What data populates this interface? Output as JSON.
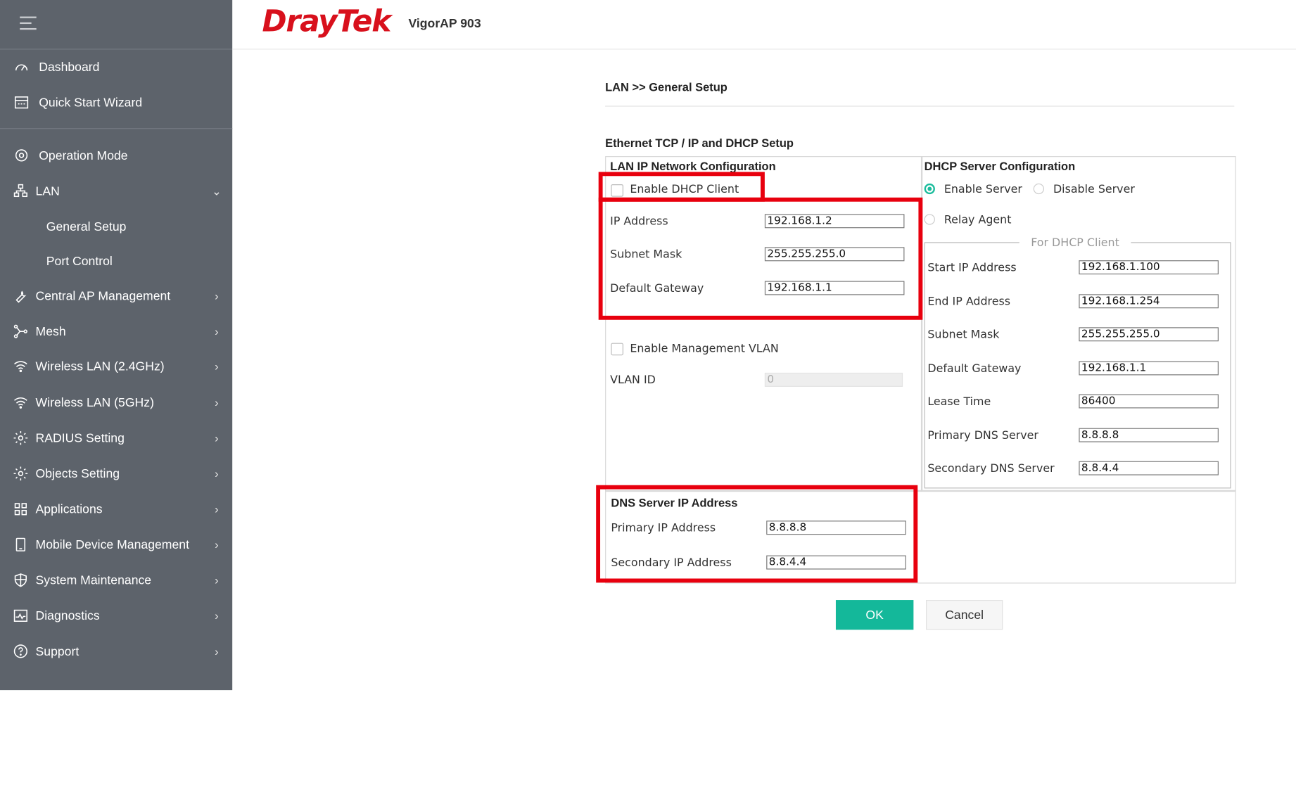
{
  "header": {
    "brand": "DrayTek",
    "model": "VigorAP 903"
  },
  "sidebar": {
    "items": [
      {
        "label": "Dashboard",
        "icon": "dashboard-icon"
      },
      {
        "label": "Quick Start Wizard",
        "icon": "wizard-icon"
      },
      {
        "label": "Operation Mode",
        "icon": "operation-mode-icon"
      },
      {
        "label": "LAN",
        "icon": "lan-icon"
      },
      {
        "label": "General Setup"
      },
      {
        "label": "Port Control"
      },
      {
        "label": "Central AP Management",
        "icon": "wrench-icon"
      },
      {
        "label": "Mesh",
        "icon": "mesh-icon"
      },
      {
        "label": "Wireless LAN (2.4GHz)",
        "icon": "wifi-icon"
      },
      {
        "label": "Wireless LAN (5GHz)",
        "icon": "wifi-icon"
      },
      {
        "label": "RADIUS Setting",
        "icon": "gear-icon"
      },
      {
        "label": "Objects Setting",
        "icon": "gear-icon"
      },
      {
        "label": "Applications",
        "icon": "applications-icon"
      },
      {
        "label": "Mobile Device Management",
        "icon": "mobile-icon"
      },
      {
        "label": "System Maintenance",
        "icon": "shield-icon"
      },
      {
        "label": "Diagnostics",
        "icon": "diagnostics-icon"
      },
      {
        "label": "Support",
        "icon": "help-icon"
      }
    ]
  },
  "page": {
    "breadcrumb": "LAN >> General Setup",
    "section_title": "Ethernet TCP / IP and DHCP Setup"
  },
  "lan": {
    "title": "LAN IP Network Configuration",
    "enable_dhcp_client": "Enable DHCP Client",
    "ip_label": "IP Address",
    "ip_value": "192.168.1.2",
    "mask_label": "Subnet Mask",
    "mask_value": "255.255.255.0",
    "gw_label": "Default Gateway",
    "gw_value": "192.168.1.1",
    "mgmt_vlan": "Enable Management VLAN",
    "vlan_label": "VLAN ID",
    "vlan_value": "0"
  },
  "dhcp": {
    "title": "DHCP Server Configuration",
    "enable_server": "Enable Server",
    "disable_server": "Disable Server",
    "relay_agent": "Relay Agent",
    "legend": "For DHCP Client",
    "start_label": "Start IP Address",
    "start_value": "192.168.1.100",
    "end_label": "End IP Address",
    "end_value": "192.168.1.254",
    "mask_label": "Subnet Mask",
    "mask_value": "255.255.255.0",
    "gw_label": "Default Gateway",
    "gw_value": "192.168.1.1",
    "lease_label": "Lease Time",
    "lease_value": "86400",
    "pdns_label": "Primary DNS Server",
    "pdns_value": "8.8.8.8",
    "sdns_label": "Secondary DNS Server",
    "sdns_value": "8.8.4.4"
  },
  "dns": {
    "title": "DNS Server IP Address",
    "primary_label": "Primary IP Address",
    "primary_value": "8.8.8.8",
    "secondary_label": "Secondary IP Address",
    "secondary_value": "8.8.4.4"
  },
  "buttons": {
    "ok": "OK",
    "cancel": "Cancel"
  },
  "colors": {
    "sidebar_bg": "#5d636b",
    "brand_red": "#d8101c",
    "accent": "#14b89a",
    "highlight": "#e8000e"
  }
}
